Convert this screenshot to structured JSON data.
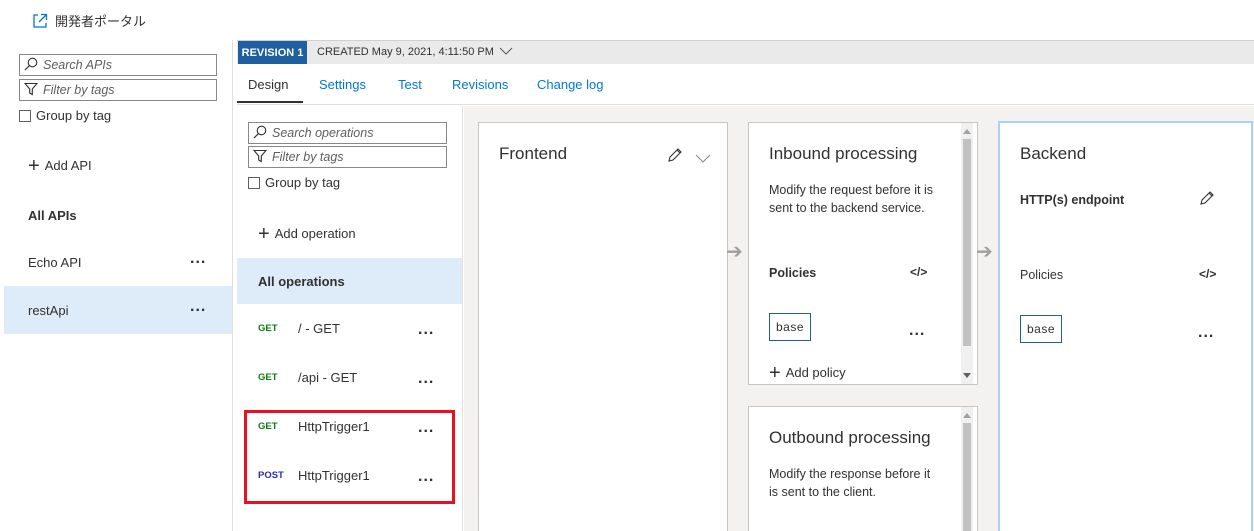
{
  "topbar": {
    "portal_label": "開発者ポータル"
  },
  "api_sidebar": {
    "search_placeholder": "Search APIs",
    "filter_placeholder": "Filter by tags",
    "group_by_tag": "Group by tag",
    "add_api": "Add API",
    "all_apis": "All APIs",
    "items": [
      {
        "label": "Echo API",
        "more": "..."
      },
      {
        "label": "restApi",
        "more": "..."
      }
    ]
  },
  "revision": {
    "badge": "REVISION 1",
    "created": "CREATED May 9, 2021, 4:11:50 PM"
  },
  "tabs": [
    "Design",
    "Settings",
    "Test",
    "Revisions",
    "Change log"
  ],
  "operations": {
    "search_placeholder": "Search operations",
    "filter_placeholder": "Filter by tags",
    "group_by_tag": "Group by tag",
    "add_operation": "Add operation",
    "all_operations": "All operations",
    "items": [
      {
        "method": "GET",
        "path": "/ - GET",
        "more": "..."
      },
      {
        "method": "GET",
        "path": "/api - GET",
        "more": "..."
      },
      {
        "method": "GET",
        "path": "HttpTrigger1",
        "more": "..."
      },
      {
        "method": "POST",
        "path": "HttpTrigger1",
        "more": "..."
      }
    ]
  },
  "frontend": {
    "title": "Frontend"
  },
  "inbound": {
    "title": "Inbound processing",
    "description": "Modify the request before it is sent to the backend service.",
    "policies": "Policies",
    "code_icon": "</>",
    "base": "base",
    "more": "...",
    "add_policy": "Add policy"
  },
  "outbound": {
    "title": "Outbound processing",
    "description": "Modify the response before it is sent to the client."
  },
  "backend": {
    "title": "Backend",
    "endpoint": "HTTP(s) endpoint",
    "policies": "Policies",
    "code_icon": "</>",
    "base": "base",
    "more": "..."
  },
  "colors": {
    "accent": "#0078d4",
    "revision_badge": "#1f5f9f",
    "selected_bg": "#deecf9",
    "get": "#107c10",
    "post": "#2b2bb5",
    "highlight": "#e81123"
  }
}
